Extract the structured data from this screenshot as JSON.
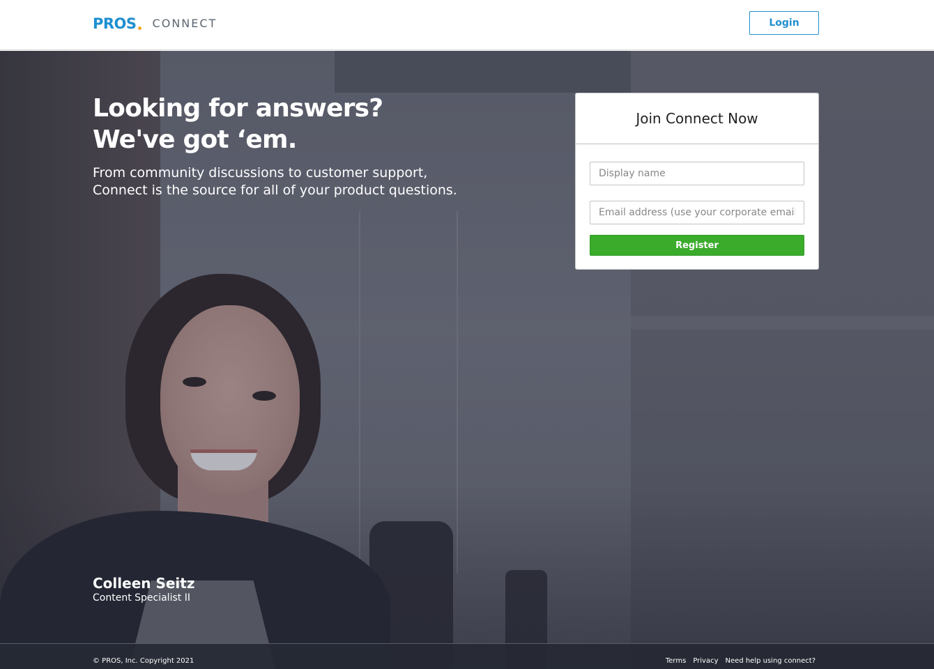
{
  "header": {
    "logo_brand": "PROS",
    "logo_product": "CONNECT",
    "login_label": "Login"
  },
  "hero": {
    "title_line1": "Looking for answers?",
    "title_line2": "We've got ‘em.",
    "subtitle_line1": "From community discussions to customer support,",
    "subtitle_line2": "Connect is the source for all of your product questions."
  },
  "person": {
    "name": "Colleen Seitz",
    "role": "Content Specialist II"
  },
  "register_card": {
    "title": "Join Connect Now",
    "display_name_placeholder": "Display name",
    "email_placeholder": "Email address (use your corporate email)",
    "register_label": "Register"
  },
  "footer": {
    "copyright": "© PROS, Inc. Copyright 2021",
    "links": [
      "Terms",
      "Privacy",
      "Need help using connect?"
    ]
  },
  "colors": {
    "brand_blue": "#1f8fd0",
    "logo_dot": "#f4a81d",
    "register_green": "#3bab2c"
  }
}
